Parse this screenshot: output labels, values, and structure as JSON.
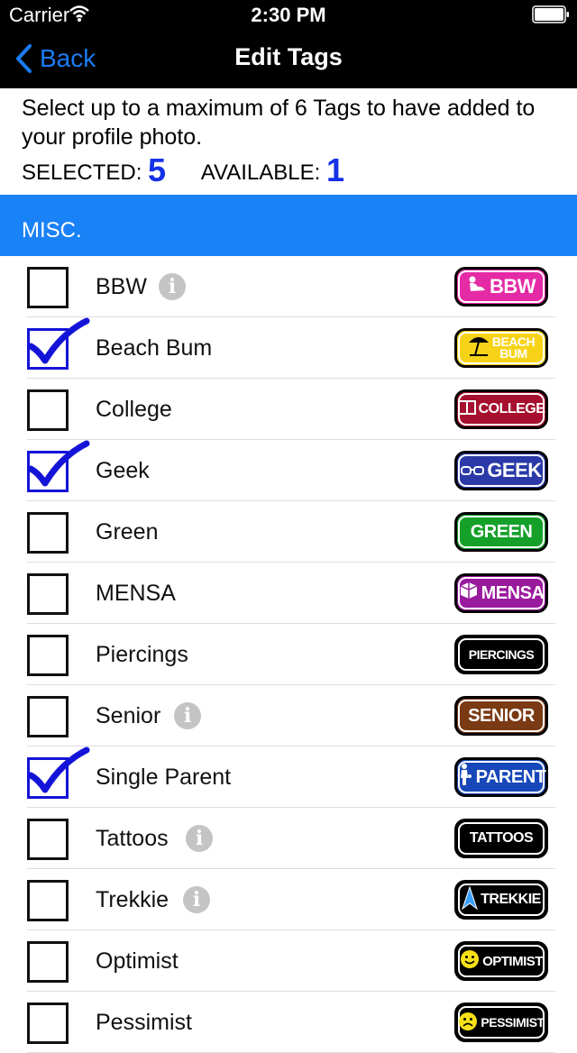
{
  "status_bar": {
    "carrier": "Carrier",
    "time": "2:30 PM"
  },
  "nav": {
    "back_label": "Back",
    "title": "Edit Tags"
  },
  "info": {
    "instructions": "Select up to a maximum of 6 Tags to have added to your profile photo.",
    "selected_label": "SELECTED:",
    "selected_count": "5",
    "available_label": "AVAILABLE:",
    "available_count": "1"
  },
  "section": {
    "title": "MISC."
  },
  "tags": [
    {
      "label": "BBW",
      "checked": false,
      "info": true,
      "badge_text": "BBW",
      "badge_icon": "lady-icon",
      "badge_color": "#e52aa5",
      "text_color": "#ffffff"
    },
    {
      "label": "Beach Bum",
      "checked": true,
      "info": false,
      "badge_text": "BEACH",
      "badge_text2": "BUM",
      "badge_icon": "umbrella-icon",
      "badge_color": "#f7d318",
      "text_color": "#ffffff"
    },
    {
      "label": "College",
      "checked": false,
      "info": false,
      "badge_text": "COLLEGE",
      "badge_icon": "book-icon",
      "badge_color": "#a6102e",
      "text_color": "#ffffff"
    },
    {
      "label": "Geek",
      "checked": true,
      "info": false,
      "badge_text": "GEEK",
      "badge_icon": "glasses-icon",
      "badge_color": "#2b3aa8",
      "text_color": "#ffffff"
    },
    {
      "label": "Green",
      "checked": false,
      "info": false,
      "badge_text": "GREEN",
      "badge_icon": "",
      "badge_color": "#15a02a",
      "text_color": "#ffffff"
    },
    {
      "label": "MENSA",
      "checked": false,
      "info": false,
      "badge_text": "MENSA",
      "badge_icon": "cube-icon",
      "badge_color": "#9a1a9e",
      "text_color": "#ffffff"
    },
    {
      "label": "Piercings",
      "checked": false,
      "info": false,
      "badge_text": "PIERCINGS",
      "badge_icon": "",
      "badge_color": "#000000",
      "text_color": "#ffffff"
    },
    {
      "label": "Senior",
      "checked": false,
      "info": true,
      "badge_text": "SENIOR",
      "badge_icon": "",
      "badge_color": "#7a3a14",
      "text_color": "#ffffff"
    },
    {
      "label": "Single Parent",
      "checked": true,
      "info": false,
      "badge_text": "PARENT",
      "badge_icon": "parent-icon",
      "badge_color": "#1747b8",
      "text_color": "#ffffff"
    },
    {
      "label": "Tattoos",
      "checked": false,
      "info": true,
      "badge_text": "TATTOOS",
      "badge_icon": "",
      "badge_color": "#000000",
      "text_color": "#ffffff"
    },
    {
      "label": "Trekkie",
      "checked": false,
      "info": true,
      "badge_text": "TREKKIE",
      "badge_icon": "starfleet-icon",
      "badge_color": "#000000",
      "text_color": "#ffffff"
    },
    {
      "label": "Optimist",
      "checked": false,
      "info": false,
      "badge_text": "OPTIMIST",
      "badge_icon": "smiley-icon",
      "badge_color": "#000000",
      "text_color": "#ffffff"
    },
    {
      "label": "Pessimist",
      "checked": false,
      "info": false,
      "badge_text": "PESSIMIST",
      "badge_icon": "frown-icon",
      "badge_color": "#000000",
      "text_color": "#ffffff"
    }
  ],
  "colors": {
    "accent": "#1a82f7",
    "check": "#1414d8",
    "count": "#1432e6"
  }
}
